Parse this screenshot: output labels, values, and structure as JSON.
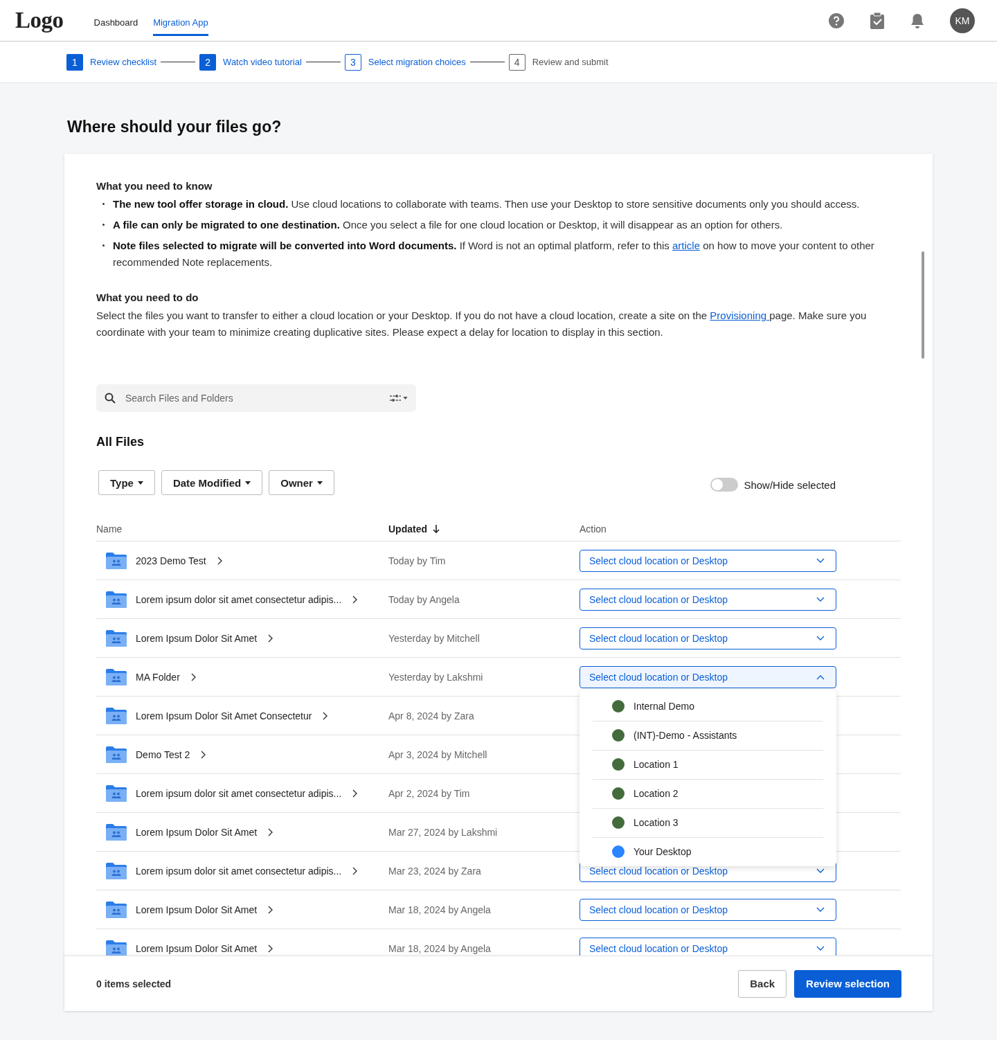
{
  "nav": {
    "logo": "Logo",
    "tabs": [
      {
        "label": "Dashboard",
        "selected": false
      },
      {
        "label": "Migration App",
        "selected": true
      }
    ],
    "avatar": "KM"
  },
  "steps": [
    {
      "number": "1",
      "label": "Review checklist",
      "completed": true,
      "selected": false
    },
    {
      "number": "2",
      "label": "Watch video tutorial",
      "completed": true,
      "selected": false
    },
    {
      "number": "3",
      "label": "Select migration choices",
      "completed": false,
      "selected": true
    },
    {
      "number": "4",
      "label": "Review and submit",
      "completed": false,
      "selected": false
    }
  ],
  "title": "Where should your files go?",
  "know": {
    "heading": "What you need to know",
    "bullets": [
      {
        "parts": [
          {
            "text": "**The new tool offer storage in cloud.** Use cloud locations to collaborate with teams. Then use your Desktop to store sensitive documents only you should access."
          }
        ]
      },
      {
        "parts": [
          {
            "text": "**A file can only be migrated to one destination.** Once you select a file for one cloud location or Desktop, it will disappear as an option for others."
          }
        ]
      },
      {
        "parts": [
          {
            "text": "**Note files selected to migrate will be converted into Word documents.** If Word is not an optimal platform, refer to this "
          },
          {
            "link": "article"
          },
          {
            "text": " on how to move your content to other recommended Note replacements."
          }
        ]
      }
    ]
  },
  "todo": {
    "heading": "What you need to do",
    "parts": [
      {
        "text": "Select the files you want to transfer to either a cloud location or your Desktop. If you do not have a cloud location, create a site on the "
      },
      {
        "link": "Provisioning "
      },
      {
        "text": "page. Make sure you coordinate with your team to minimize creating duplicative sites. Please expect a delay for location to display in this section."
      }
    ]
  },
  "search": {
    "placeholder": "Search Files and Folders"
  },
  "section_title": "All Files",
  "filters": [
    "Type",
    "Date Modified",
    "Owner"
  ],
  "toggle": {
    "label": "Show/Hide selected",
    "on": false
  },
  "table": {
    "columns": [
      "Name",
      "Updated",
      "Action"
    ],
    "rows": [
      {
        "name": "2023 Demo Test",
        "updated": "Today by Tim",
        "action": "Select cloud location or Desktop",
        "expanded": false
      },
      {
        "name": "Lorem ipsum dolor sit amet consectetur adipis...",
        "updated": "Today by Angela",
        "action": "Select cloud location or Desktop",
        "expanded": false
      },
      {
        "name": "Lorem Ipsum Dolor Sit Amet",
        "updated": "Yesterday by Mitchell",
        "action": "Select cloud location or Desktop",
        "expanded": false
      },
      {
        "name": "MA Folder",
        "updated": "Yesterday by Lakshmi",
        "action": "Select cloud location or Desktop",
        "expanded": true,
        "menu": [
          {
            "label": "Internal Demo",
            "color": "#436b3c"
          },
          {
            "label": "(INT)-Demo - Assistants",
            "color": "#436b3c"
          },
          {
            "label": "Location 1",
            "color": "#436b3c"
          },
          {
            "label": "Location 2",
            "color": "#436b3c"
          },
          {
            "label": "Location 3",
            "color": "#436b3c"
          },
          {
            "label": "Your Desktop",
            "color": "#2a85ff"
          }
        ]
      },
      {
        "name": "Lorem Ipsum Dolor Sit Amet Consectetur",
        "updated": "Apr 8, 2024 by Zara"
      },
      {
        "name": "Demo Test 2",
        "updated": "Apr 3, 2024 by Mitchell"
      },
      {
        "name": "Lorem ipsum dolor sit amet consectetur adipis...",
        "updated": "Apr 2, 2024 by Tim"
      },
      {
        "name": "Lorem Ipsum Dolor Sit Amet",
        "updated": "Mar 27, 2024 by Lakshmi"
      },
      {
        "name": "Lorem ipsum dolor sit amet consectetur adipis...",
        "updated": "Mar 23, 2024 by Zara",
        "action": "Select cloud location or Desktop",
        "expanded": false
      },
      {
        "name": "Lorem Ipsum Dolor Sit Amet",
        "updated": "Mar 18, 2024 by Angela",
        "action": "Select cloud location or Desktop",
        "expanded": false
      },
      {
        "name": "Lorem Ipsum Dolor Sit Amet",
        "updated": "Mar 18, 2024 by Angela",
        "action": "Select cloud location or Desktop",
        "expanded": false
      }
    ]
  },
  "footer": {
    "count": "0 items selected",
    "buttons": [
      {
        "label": "Back",
        "kind": "secondary"
      },
      {
        "label": "Review selection",
        "kind": "primary"
      }
    ]
  }
}
